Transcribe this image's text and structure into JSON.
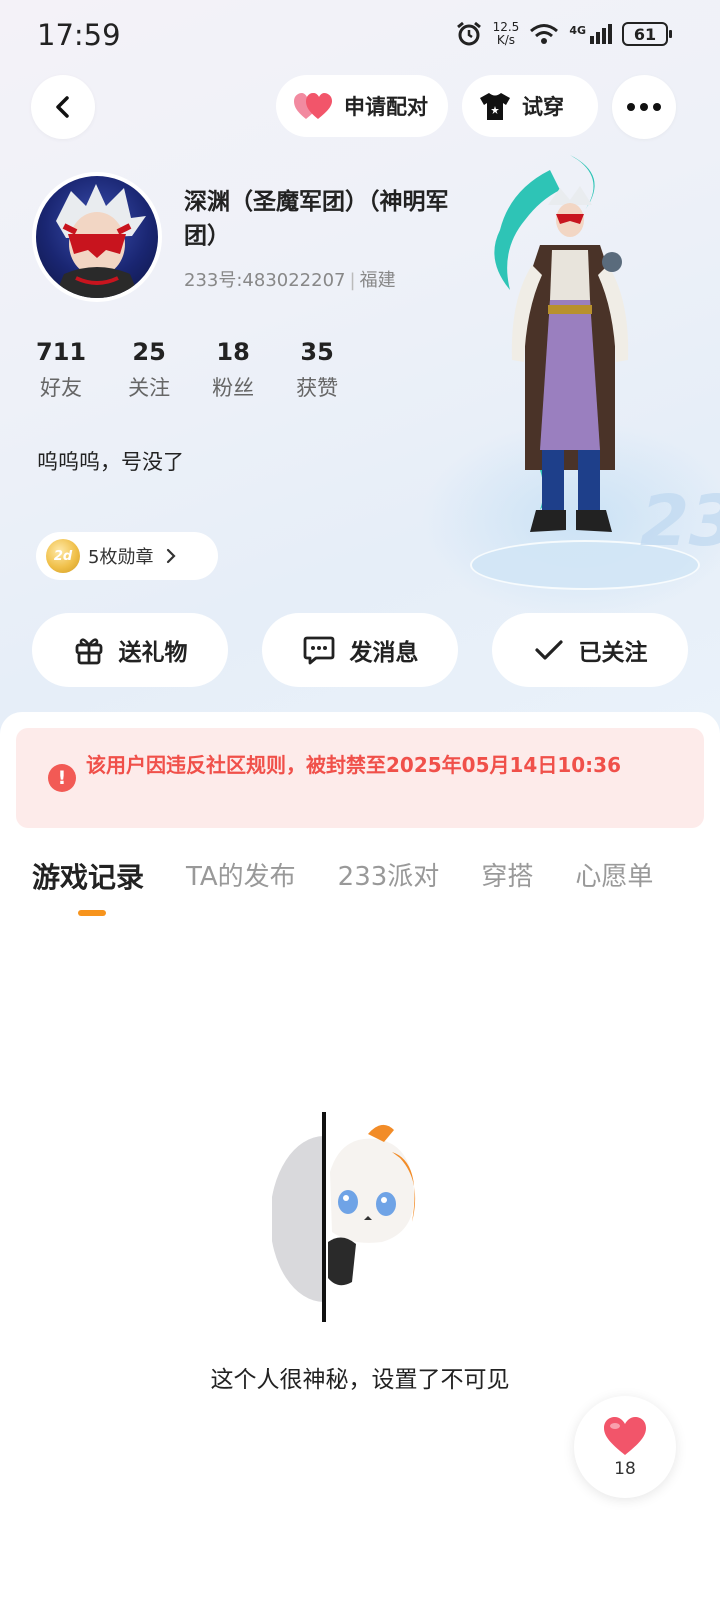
{
  "status_bar": {
    "time": "17:59",
    "net_speed_value": "12.5",
    "net_speed_unit": "K/s",
    "network_type": "4G",
    "battery": "61"
  },
  "header": {
    "pair_label": "申请配对",
    "tryon_label": "试穿"
  },
  "profile": {
    "name": "深渊（圣魔军团）（神明军团）",
    "id_text": "233号:483022207",
    "location": "福建",
    "stats": [
      {
        "value": "711",
        "label": "好友"
      },
      {
        "value": "25",
        "label": "关注"
      },
      {
        "value": "18",
        "label": "粉丝"
      },
      {
        "value": "35",
        "label": "获赞"
      }
    ],
    "bio": "呜呜呜，号没了",
    "badges_label": "5枚勋章"
  },
  "actions": {
    "gift_label": "送礼物",
    "message_label": "发消息",
    "follow_label": "已关注"
  },
  "ban_notice": "该用户因违反社区规则，被封禁至2025年05月14日10:36",
  "tabs": [
    {
      "label": "游戏记录",
      "active": true
    },
    {
      "label": "TA的发布",
      "active": false
    },
    {
      "label": "233派对",
      "active": false
    },
    {
      "label": "穿搭",
      "active": false
    },
    {
      "label": "心愿单",
      "active": false
    }
  ],
  "empty_state": {
    "message": "这个人很神秘，设置了不可见"
  },
  "like_fab": {
    "count": "18"
  },
  "colors": {
    "accent": "#f7941d",
    "ban_bg": "#fdebea",
    "ban_text": "#f0504a",
    "heart": "#f2556a"
  }
}
